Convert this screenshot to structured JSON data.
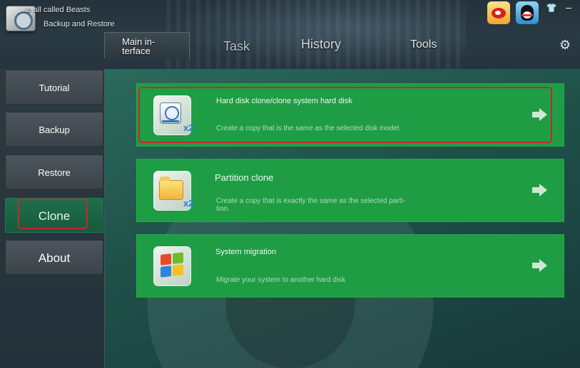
{
  "app": {
    "title": "re all called Beasts",
    "subtitle": "Backup and Restore"
  },
  "top_icons": {
    "weibo": "weibo-icon",
    "qq": "qq-icon",
    "skin": "shirt-icon",
    "minimize": "minimize-icon"
  },
  "tabs": [
    {
      "label": "Main in-\nterface",
      "active": true
    },
    {
      "label": "Task",
      "active": false
    },
    {
      "label": "History",
      "active": false
    },
    {
      "label": "Tools",
      "active": false
    }
  ],
  "sidebar": {
    "items": [
      {
        "label": "Tutorial"
      },
      {
        "label": "Backup"
      },
      {
        "label": "Restore"
      },
      {
        "label": "Clone",
        "active": true
      },
      {
        "label": "About"
      }
    ]
  },
  "cards": [
    {
      "title": "Hard disk clone/clone system hard disk",
      "description": "Create a copy that is the same as the selected disk model.",
      "icon": "hard-disk-icon",
      "badge": "x2"
    },
    {
      "title": "Partition clone",
      "description": "Create a copy that is exactly the same as the selected parti-\ntion.",
      "icon": "folder-icon",
      "badge": "x2"
    },
    {
      "title": "System migration",
      "description": "Migrate your system to another hard disk",
      "icon": "windows-logo-icon",
      "badge": ""
    }
  ],
  "colors": {
    "accent": "#1e9d44",
    "highlight_outline": "#c9252b",
    "active_sidebar": "#1e6f4c"
  }
}
